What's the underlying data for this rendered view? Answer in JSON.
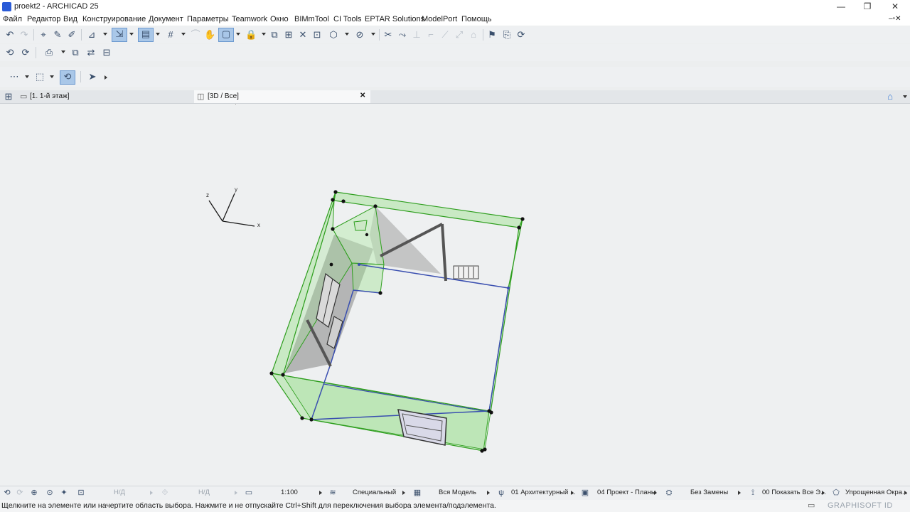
{
  "window": {
    "title": "proekt2 - ARCHICAD 25",
    "minimize_glyph": "—",
    "maximize_glyph": "❐",
    "close_glyph": "✕",
    "inner_controls_glyphs": "–▫✕"
  },
  "menu": [
    "Файл",
    "Редактор",
    "Вид",
    "Конструирование",
    "Документ",
    "Параметры",
    "Teamwork",
    "Окно",
    "BIMmTool",
    "CI Tools",
    "EPTAR Solutions",
    "ModelPort",
    "Помощь"
  ],
  "tabs": {
    "floor_plan": "[1. 1-й этаж]",
    "view_3d": "[3D / Все]",
    "close_glyph": "✕"
  },
  "axes": {
    "x": "x",
    "y": "y",
    "z": "z"
  },
  "status": {
    "nd_1": "Н/Д",
    "nd_2": "Н/Д",
    "scale": "1:100",
    "structure": "Специальный",
    "model": "Вся Модель",
    "layer": "01 Архитектурный ...",
    "view_set": "04 Проект - Планы",
    "override": "Без Замены",
    "renovation": "00 Показать Все Э...",
    "view_mode": "Упрощенная Окра..."
  },
  "hint": "Щелкните на элементе или начертите область выбора. Нажмите и не отпускайте Ctrl+Shift для переключения выбора элемента/подэлемента.",
  "brand": "GRAPHISOFT ID",
  "colors": {
    "wall_fill": "#9be08f",
    "wall_stroke": "#2e9e1e",
    "floor_edge": "#3a4fb0",
    "accent": "#2a5bd7"
  },
  "icons": {
    "undo": "↶",
    "redo": "↷",
    "select": "➚",
    "grid": "#",
    "window_box": "▢",
    "arrow": "➤"
  }
}
